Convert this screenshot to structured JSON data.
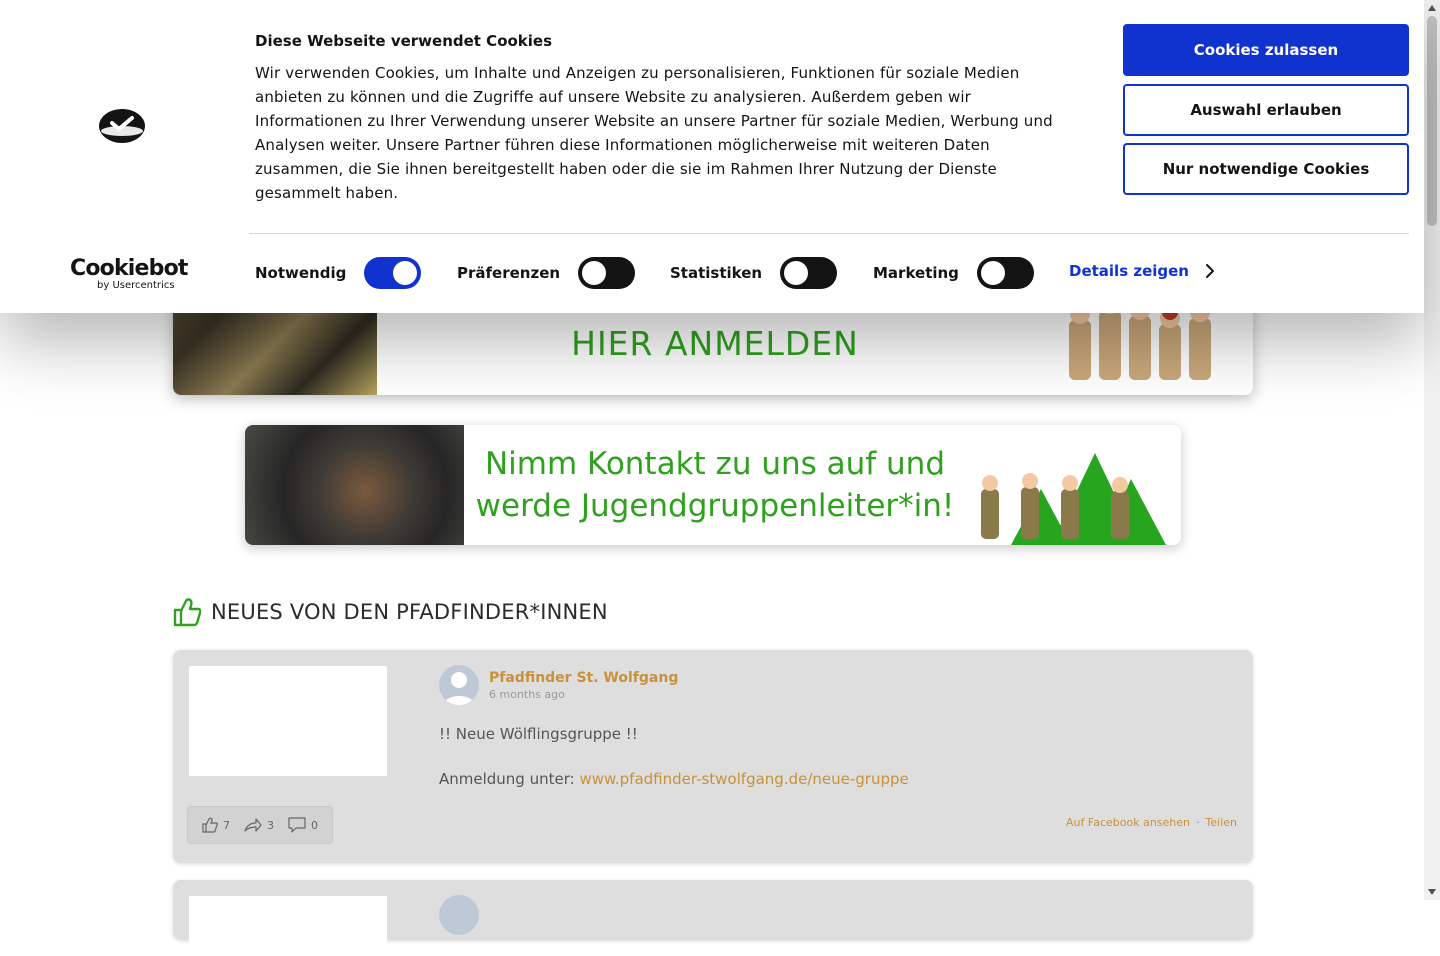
{
  "cookie_banner": {
    "title": "Diese Webseite verwendet Cookies",
    "text": "Wir verwenden Cookies, um Inhalte und Anzeigen zu personalisieren, Funktionen für soziale Medien anbieten zu können und die Zugriffe auf unsere Website zu analysieren. Außerdem geben wir Informationen zu Ihrer Verwendung unserer Website an unsere Partner für soziale Medien, Werbung und Analysen weiter. Unsere Partner führen diese Informationen möglicherweise mit weiteren Daten zusammen, die Sie ihnen bereitgestellt haben oder die sie im Rahmen Ihrer Nutzung der Dienste gesammelt haben.",
    "buttons": {
      "allow_all": "Cookies zulassen",
      "allow_selection": "Auswahl erlauben",
      "necessary_only": "Nur notwendige Cookies"
    },
    "toggles": [
      {
        "label": "Notwendig",
        "checked": true
      },
      {
        "label": "Präferenzen",
        "checked": false
      },
      {
        "label": "Statistiken",
        "checked": false
      },
      {
        "label": "Marketing",
        "checked": false
      }
    ],
    "details_link": "Details zeigen",
    "brand": {
      "name": "Cookiebot",
      "sub": "by Usercentrics"
    },
    "accent_color": "#1032cf"
  },
  "banners": {
    "first": {
      "headline": "HIER ANMELDEN"
    },
    "second": {
      "line1": "Nimm Kontakt zu uns auf und",
      "line2": "werde Jugendgruppenleiter*in!"
    }
  },
  "feed": {
    "section_title": "NEUES VON DEN PFADFINDER*INNEN",
    "posts": [
      {
        "author": "Pfadfinder St. Wolfgang",
        "time": "6 months ago",
        "message_line1": "!! Neue Wölflingsgruppe !!",
        "message_prefix": "Anmeldung unter: ",
        "link_text": "www.pfadfinder-stwolfgang.de/neue-gruppe",
        "likes": "7",
        "shares": "3",
        "comments": "0",
        "action_view": "Auf Facebook ansehen",
        "action_separator": "·",
        "action_share": "Teilen"
      }
    ]
  }
}
